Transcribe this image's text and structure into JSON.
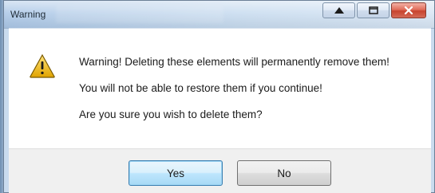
{
  "window": {
    "title": "Warning",
    "caption_buttons": [
      "up-arrow-icon",
      "restore-icon",
      "close-icon"
    ]
  },
  "dialog": {
    "icon": "warning-triangle-icon",
    "lines": [
      "Warning! Deleting these elements will permanently remove them!",
      "You will not be able to restore them if you continue!",
      "Are you sure you wish to delete them?"
    ],
    "buttons": {
      "yes": "Yes",
      "no": "No"
    }
  },
  "colors": {
    "titlebar": "#c9dbee",
    "warning_icon": "#f2c12e",
    "close_button": "#c7432e",
    "default_button_border": "#3c7fb1"
  }
}
